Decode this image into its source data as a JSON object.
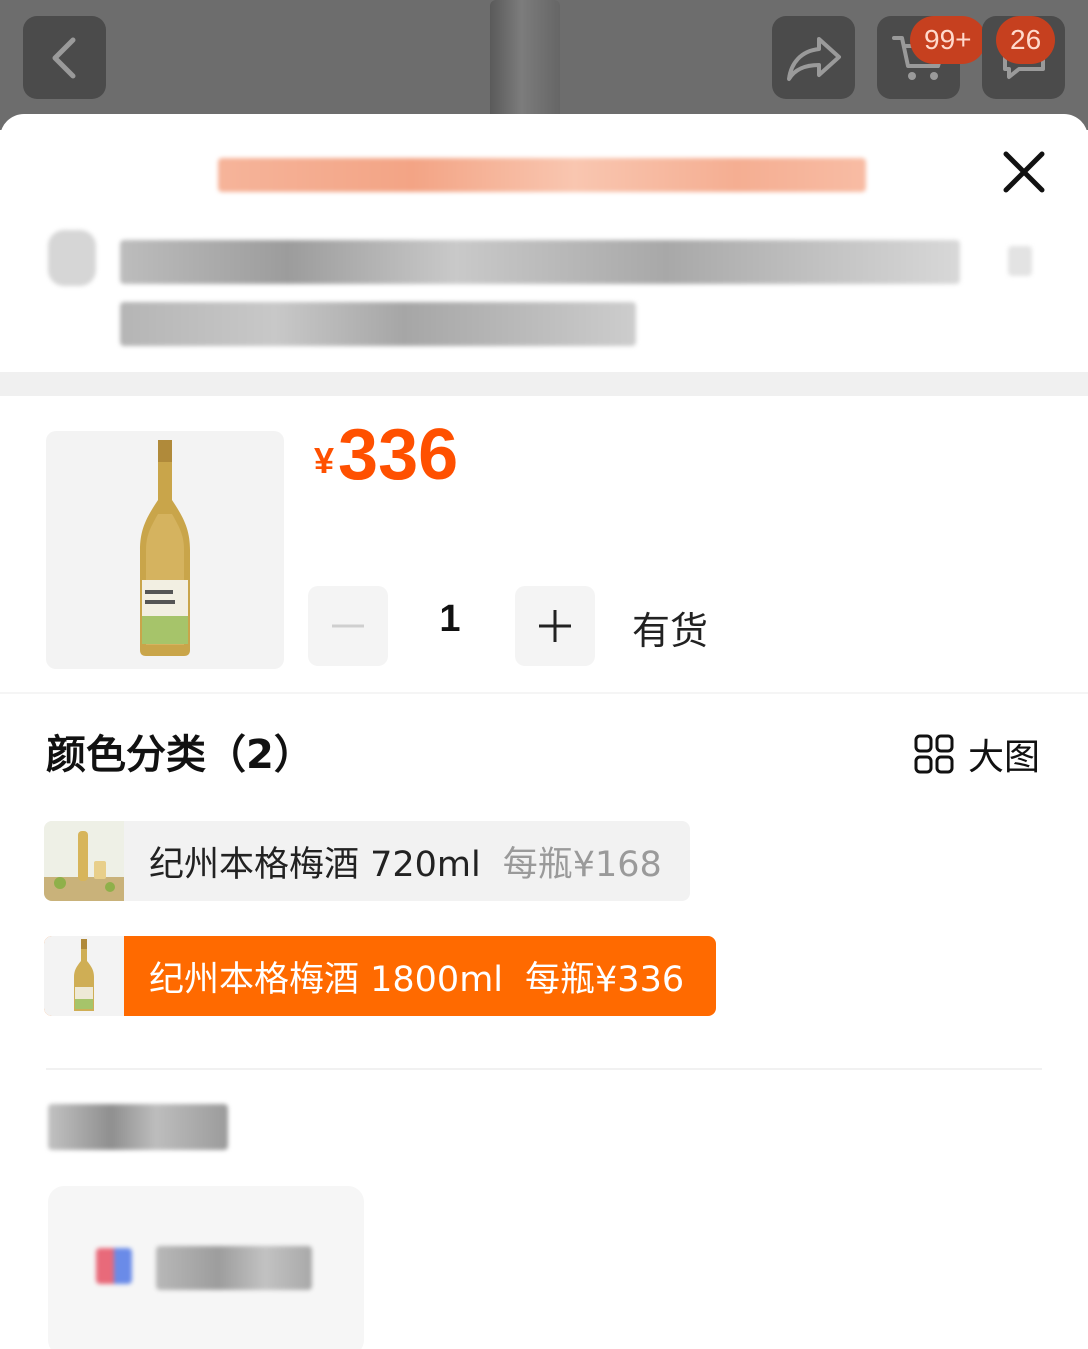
{
  "topbar": {
    "back_icon": "chevron-left-icon",
    "share_icon": "share-icon",
    "cart_icon": "cart-icon",
    "cart_badge": "99+",
    "msg_badge": "26"
  },
  "sheet": {
    "close_icon": "close-icon"
  },
  "product": {
    "currency": "¥",
    "price": "336",
    "quantity": "1",
    "stock": "有货"
  },
  "spec": {
    "title": "颜色分类（2）",
    "bigview_label": "大图",
    "options": [
      {
        "name": "纪州本格梅酒 720ml",
        "per": "每瓶¥168",
        "selected": false
      },
      {
        "name": "纪州本格梅酒 1800ml",
        "per": "每瓶¥336",
        "selected": true
      }
    ]
  },
  "colors": {
    "accent": "#ff5000",
    "selected_bg": "#ff6a00"
  }
}
